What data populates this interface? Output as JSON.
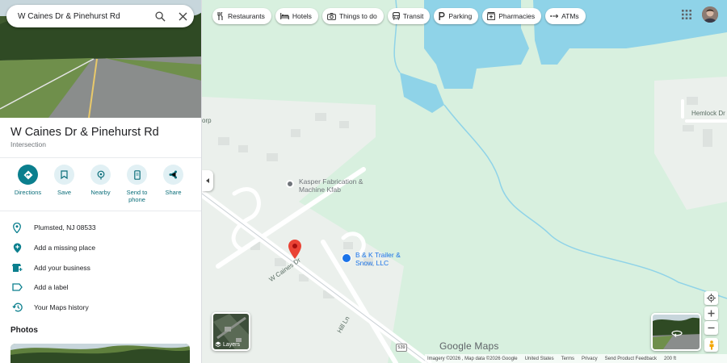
{
  "search": {
    "query": "W Caines Dr & Pinehurst Rd"
  },
  "place": {
    "title": "W Caines Dr & Pinehurst Rd",
    "subtitle": "Intersection"
  },
  "actions": [
    {
      "label": "Directions",
      "icon": "directions-icon"
    },
    {
      "label": "Save",
      "icon": "bookmark-icon"
    },
    {
      "label": "Nearby",
      "icon": "nearby-icon"
    },
    {
      "label": "Send to phone",
      "icon": "phone-icon"
    },
    {
      "label": "Share",
      "icon": "share-icon"
    }
  ],
  "info_rows": [
    {
      "text": "Plumsted, NJ 08533",
      "icon": "location-pin-icon"
    },
    {
      "text": "Add a missing place",
      "icon": "add-place-icon"
    },
    {
      "text": "Add your business",
      "icon": "business-icon"
    },
    {
      "text": "Add a label",
      "icon": "label-icon"
    },
    {
      "text": "Your Maps history",
      "icon": "history-icon"
    }
  ],
  "photos_heading": "Photos",
  "chips": [
    {
      "label": "Restaurants",
      "icon": "restaurant-icon"
    },
    {
      "label": "Hotels",
      "icon": "hotel-icon"
    },
    {
      "label": "Things to do",
      "icon": "camera-icon"
    },
    {
      "label": "Transit",
      "icon": "transit-icon"
    },
    {
      "label": "Parking",
      "icon": "parking-icon"
    },
    {
      "label": "Pharmacies",
      "icon": "pharmacy-icon"
    },
    {
      "label": "ATMs",
      "icon": "atm-icon"
    }
  ],
  "map": {
    "labels": {
      "corp": "orp",
      "hemlock": "Hemlock Dr",
      "caines": "W Caines Dr",
      "hill": "Hill Ln",
      "route": "539"
    },
    "pois": [
      {
        "name": "Kasper Fabrication & Machine Kfab",
        "color": "#70757a"
      },
      {
        "name": "B & K Trailer & Snow, LLC",
        "color": "#1a73e8"
      }
    ],
    "layers_label": "Layers",
    "logo": "Google Maps",
    "attribution": [
      "Imagery ©2026 , Map data ©2026 Google",
      "United States",
      "Terms",
      "Privacy",
      "Send Product Feedback",
      "200 ft"
    ]
  },
  "colors": {
    "water": "#8fd3e8",
    "land": "#d8f0df",
    "road": "#ffffff",
    "accent": "#0b7f8e",
    "pin": "#ea4335"
  }
}
